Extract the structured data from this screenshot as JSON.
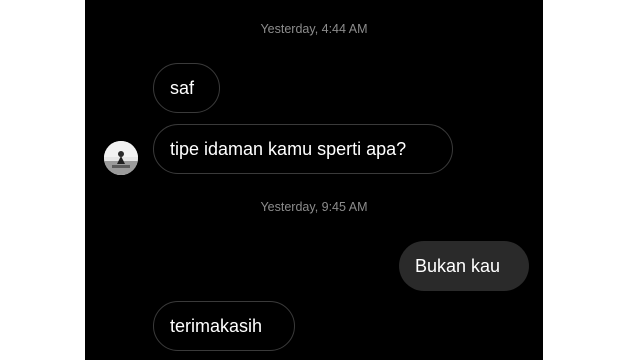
{
  "conversation": {
    "timestamps": [
      "Yesterday, 4:44 AM",
      "Yesterday, 9:45 AM"
    ],
    "messages": [
      {
        "sender": "other",
        "text": "saf"
      },
      {
        "sender": "other",
        "text": "tipe idaman kamu sperti apa?"
      },
      {
        "sender": "me",
        "text": "Bukan kau"
      },
      {
        "sender": "other",
        "text": "terimakasih"
      }
    ]
  },
  "colors": {
    "background": "#000000",
    "incoming_border": "#3a3a3a",
    "outgoing_bubble": "#2a2a2a",
    "timestamp_text": "#8c8c8c"
  },
  "icons": {
    "contact_avatar": "avatar-icon"
  }
}
